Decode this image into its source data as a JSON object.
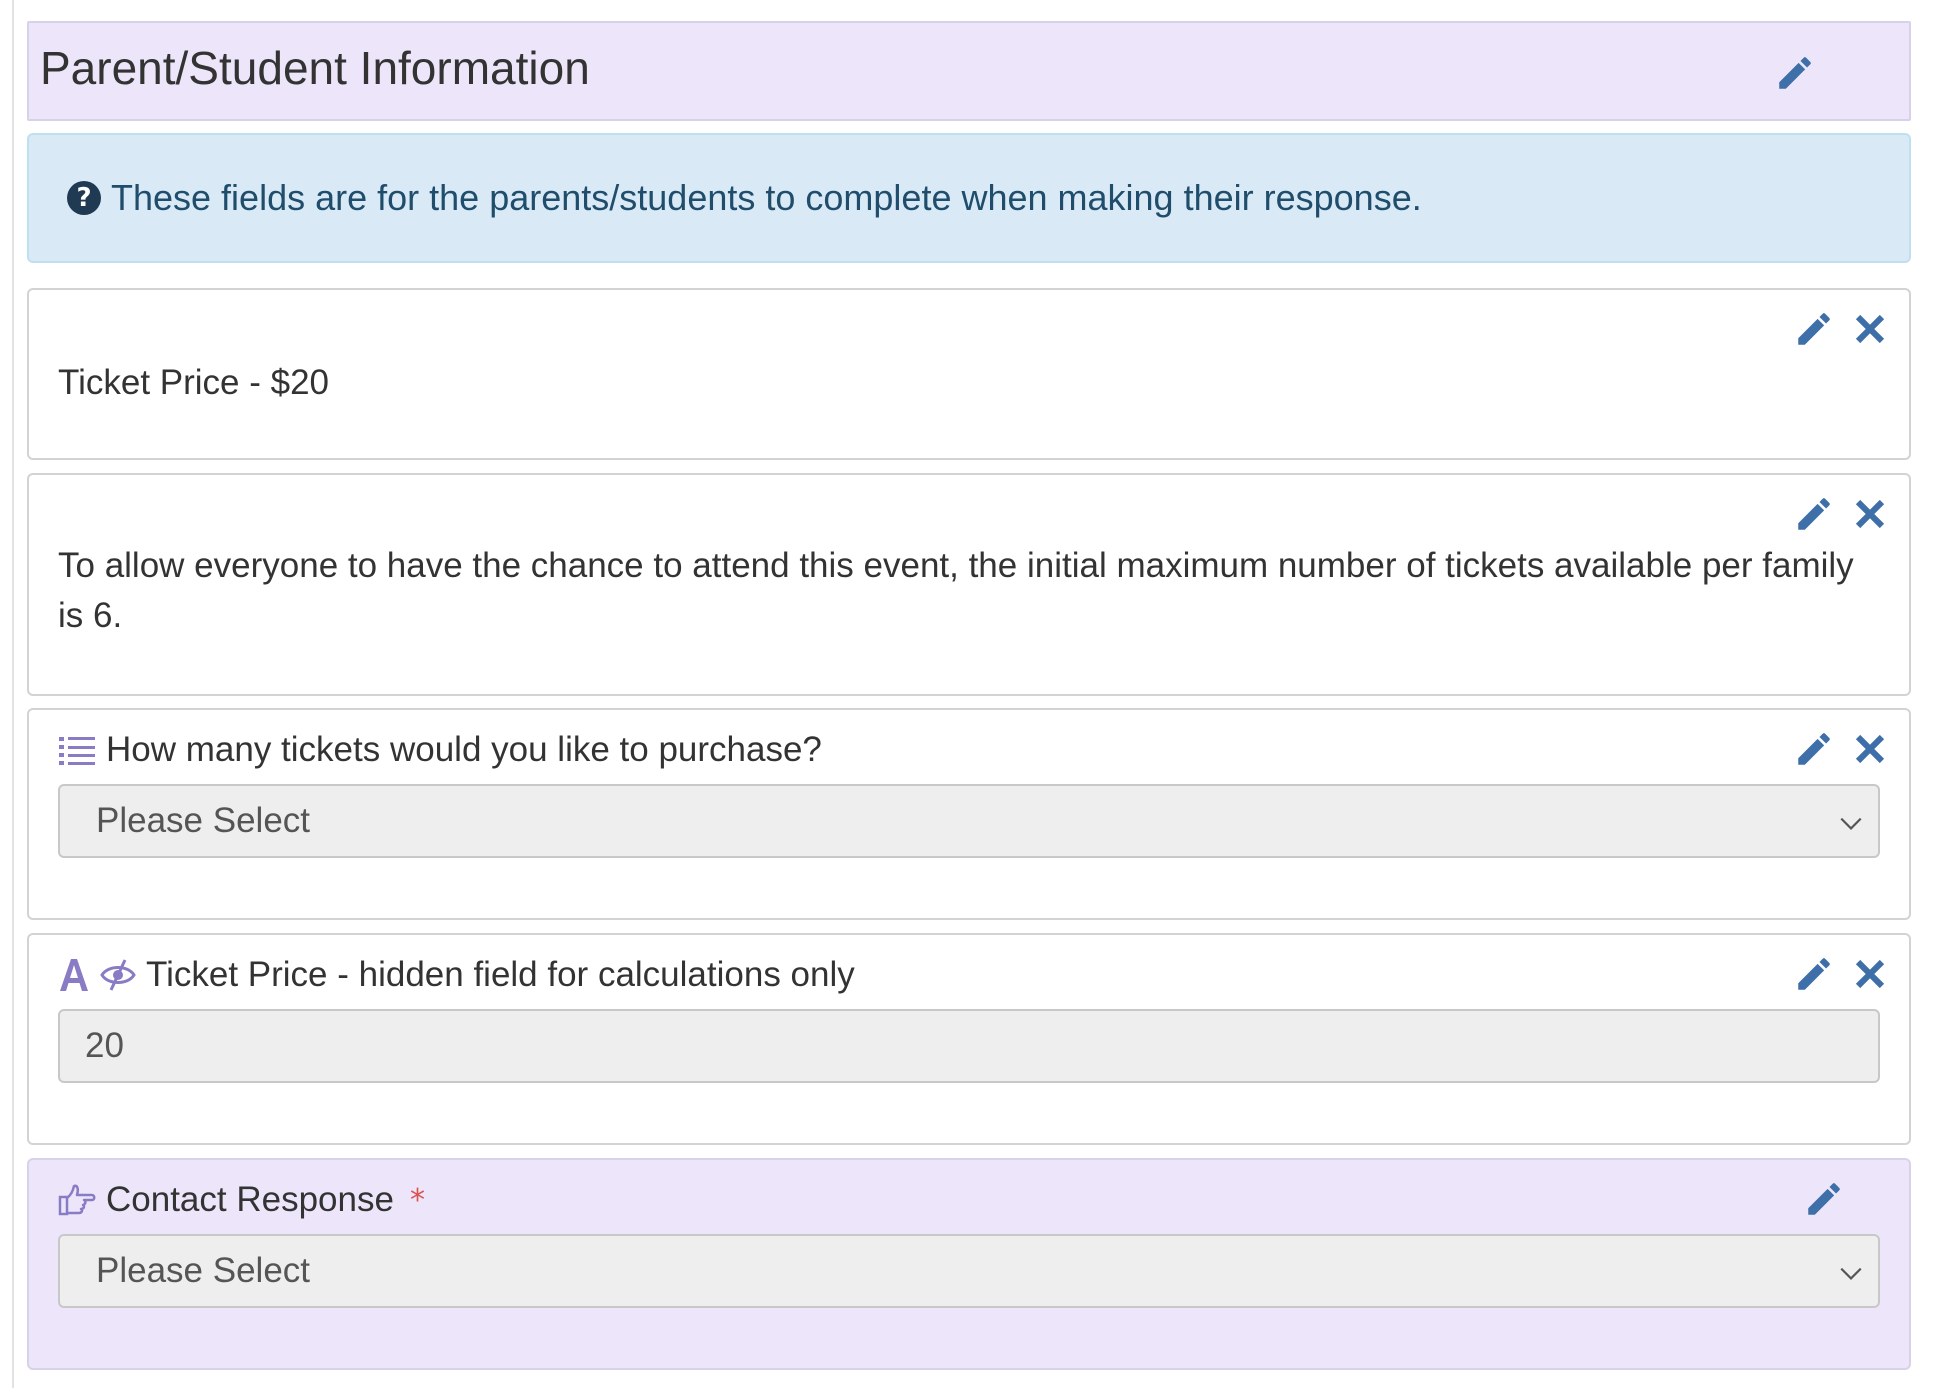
{
  "header": {
    "title": "Parent/Student Information"
  },
  "info": {
    "text": "These fields are for the parents/students to complete when making their response.",
    "icon": "question-circle-icon"
  },
  "blocks": [
    {
      "type": "text",
      "text": "Ticket Price - $20"
    },
    {
      "type": "text",
      "text": "To allow everyone to have the chance to attend this event, the initial maximum number of tickets available per family is 6."
    },
    {
      "type": "select",
      "label": "How many tickets would you like to purchase?",
      "value": "Please Select",
      "icon": "list-icon"
    },
    {
      "type": "hidden-text",
      "label": "Ticket Price - hidden field for calculations only",
      "value": "20",
      "icons": [
        "text-field-icon",
        "hidden-eye-icon"
      ]
    },
    {
      "type": "contact-select",
      "label": "Contact Response",
      "required_mark": "*",
      "value": "Please Select",
      "icon": "pointing-hand-icon"
    }
  ],
  "colors": {
    "accent_purple_bg": "#ede6fb",
    "info_bg": "#d9eaf6",
    "action_icon": "#3e6fa8",
    "type_icon": "#8a7cc4",
    "required": "#d9534f"
  }
}
